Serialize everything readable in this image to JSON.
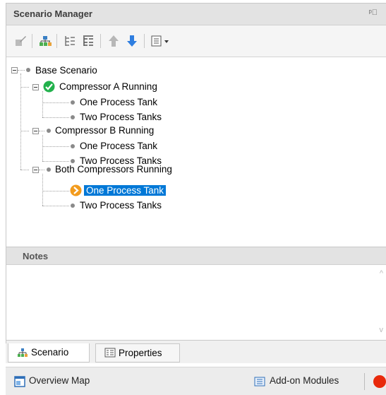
{
  "panel": {
    "title": "Scenario Manager",
    "pin_icon": "pin-icon"
  },
  "toolbar": {
    "icons": [
      "rename-icon",
      "new-child-scenario-icon",
      "collapse-icon",
      "expand-icon",
      "move-up-icon",
      "move-down-icon",
      "view-options-icon"
    ]
  },
  "tree": {
    "base": "Base Scenario",
    "a": "Compressor A Running",
    "a1": "One Process Tank",
    "a2": "Two Process Tanks",
    "b": "Compressor B Running",
    "b1": "One Process Tank",
    "b2": "Two Process Tanks",
    "c": "Both Compressors Running",
    "c1": "One Process Tank",
    "c2": "Two Process Tanks"
  },
  "notes": {
    "title": "Notes"
  },
  "tabs": {
    "scenario": "Scenario",
    "properties": "Properties"
  },
  "statusbar": {
    "overview": "Overview Map",
    "addons": "Add-on Modules"
  },
  "colors": {
    "selection": "#0078d7",
    "check": "#22b14c",
    "current": "#f29b1d"
  }
}
